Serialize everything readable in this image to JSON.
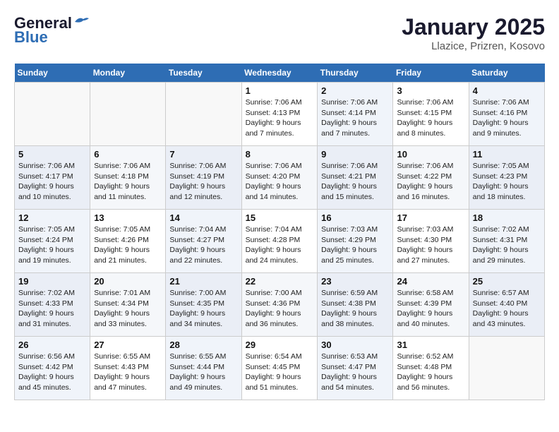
{
  "header": {
    "logo_general": "General",
    "logo_blue": "Blue",
    "title": "January 2025",
    "subtitle": "Llazice, Prizren, Kosovo"
  },
  "weekdays": [
    "Sunday",
    "Monday",
    "Tuesday",
    "Wednesday",
    "Thursday",
    "Friday",
    "Saturday"
  ],
  "weeks": [
    [
      {
        "day": "",
        "text": ""
      },
      {
        "day": "",
        "text": ""
      },
      {
        "day": "",
        "text": ""
      },
      {
        "day": "1",
        "text": "Sunrise: 7:06 AM\nSunset: 4:13 PM\nDaylight: 9 hours and 7 minutes."
      },
      {
        "day": "2",
        "text": "Sunrise: 7:06 AM\nSunset: 4:14 PM\nDaylight: 9 hours and 7 minutes."
      },
      {
        "day": "3",
        "text": "Sunrise: 7:06 AM\nSunset: 4:15 PM\nDaylight: 9 hours and 8 minutes."
      },
      {
        "day": "4",
        "text": "Sunrise: 7:06 AM\nSunset: 4:16 PM\nDaylight: 9 hours and 9 minutes."
      }
    ],
    [
      {
        "day": "5",
        "text": "Sunrise: 7:06 AM\nSunset: 4:17 PM\nDaylight: 9 hours and 10 minutes."
      },
      {
        "day": "6",
        "text": "Sunrise: 7:06 AM\nSunset: 4:18 PM\nDaylight: 9 hours and 11 minutes."
      },
      {
        "day": "7",
        "text": "Sunrise: 7:06 AM\nSunset: 4:19 PM\nDaylight: 9 hours and 12 minutes."
      },
      {
        "day": "8",
        "text": "Sunrise: 7:06 AM\nSunset: 4:20 PM\nDaylight: 9 hours and 14 minutes."
      },
      {
        "day": "9",
        "text": "Sunrise: 7:06 AM\nSunset: 4:21 PM\nDaylight: 9 hours and 15 minutes."
      },
      {
        "day": "10",
        "text": "Sunrise: 7:06 AM\nSunset: 4:22 PM\nDaylight: 9 hours and 16 minutes."
      },
      {
        "day": "11",
        "text": "Sunrise: 7:05 AM\nSunset: 4:23 PM\nDaylight: 9 hours and 18 minutes."
      }
    ],
    [
      {
        "day": "12",
        "text": "Sunrise: 7:05 AM\nSunset: 4:24 PM\nDaylight: 9 hours and 19 minutes."
      },
      {
        "day": "13",
        "text": "Sunrise: 7:05 AM\nSunset: 4:26 PM\nDaylight: 9 hours and 21 minutes."
      },
      {
        "day": "14",
        "text": "Sunrise: 7:04 AM\nSunset: 4:27 PM\nDaylight: 9 hours and 22 minutes."
      },
      {
        "day": "15",
        "text": "Sunrise: 7:04 AM\nSunset: 4:28 PM\nDaylight: 9 hours and 24 minutes."
      },
      {
        "day": "16",
        "text": "Sunrise: 7:03 AM\nSunset: 4:29 PM\nDaylight: 9 hours and 25 minutes."
      },
      {
        "day": "17",
        "text": "Sunrise: 7:03 AM\nSunset: 4:30 PM\nDaylight: 9 hours and 27 minutes."
      },
      {
        "day": "18",
        "text": "Sunrise: 7:02 AM\nSunset: 4:31 PM\nDaylight: 9 hours and 29 minutes."
      }
    ],
    [
      {
        "day": "19",
        "text": "Sunrise: 7:02 AM\nSunset: 4:33 PM\nDaylight: 9 hours and 31 minutes."
      },
      {
        "day": "20",
        "text": "Sunrise: 7:01 AM\nSunset: 4:34 PM\nDaylight: 9 hours and 33 minutes."
      },
      {
        "day": "21",
        "text": "Sunrise: 7:00 AM\nSunset: 4:35 PM\nDaylight: 9 hours and 34 minutes."
      },
      {
        "day": "22",
        "text": "Sunrise: 7:00 AM\nSunset: 4:36 PM\nDaylight: 9 hours and 36 minutes."
      },
      {
        "day": "23",
        "text": "Sunrise: 6:59 AM\nSunset: 4:38 PM\nDaylight: 9 hours and 38 minutes."
      },
      {
        "day": "24",
        "text": "Sunrise: 6:58 AM\nSunset: 4:39 PM\nDaylight: 9 hours and 40 minutes."
      },
      {
        "day": "25",
        "text": "Sunrise: 6:57 AM\nSunset: 4:40 PM\nDaylight: 9 hours and 43 minutes."
      }
    ],
    [
      {
        "day": "26",
        "text": "Sunrise: 6:56 AM\nSunset: 4:42 PM\nDaylight: 9 hours and 45 minutes."
      },
      {
        "day": "27",
        "text": "Sunrise: 6:55 AM\nSunset: 4:43 PM\nDaylight: 9 hours and 47 minutes."
      },
      {
        "day": "28",
        "text": "Sunrise: 6:55 AM\nSunset: 4:44 PM\nDaylight: 9 hours and 49 minutes."
      },
      {
        "day": "29",
        "text": "Sunrise: 6:54 AM\nSunset: 4:45 PM\nDaylight: 9 hours and 51 minutes."
      },
      {
        "day": "30",
        "text": "Sunrise: 6:53 AM\nSunset: 4:47 PM\nDaylight: 9 hours and 54 minutes."
      },
      {
        "day": "31",
        "text": "Sunrise: 6:52 AM\nSunset: 4:48 PM\nDaylight: 9 hours and 56 minutes."
      },
      {
        "day": "",
        "text": ""
      }
    ]
  ]
}
